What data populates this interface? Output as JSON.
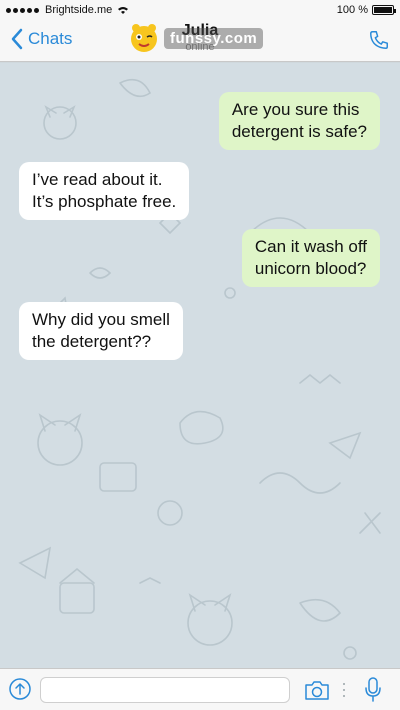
{
  "status_bar": {
    "carrier": "Brightside.me",
    "time": "",
    "battery_percent": "100 %",
    "battery_level": 1.0
  },
  "nav": {
    "back_label": "Chats",
    "contact_name": "Julia",
    "contact_status": "online"
  },
  "watermark": {
    "text": "funssy.com"
  },
  "messages": [
    {
      "direction": "out",
      "lines": [
        "Are you sure this",
        "detergent is safe?"
      ]
    },
    {
      "direction": "in",
      "lines": [
        "I’ve read about it.",
        "It’s phosphate free."
      ]
    },
    {
      "direction": "out",
      "lines": [
        "Can it wash off",
        "unicorn blood?"
      ]
    },
    {
      "direction": "in",
      "lines": [
        "Why did you smell",
        "the detergent??"
      ]
    }
  ],
  "input": {
    "value": "",
    "placeholder": ""
  },
  "colors": {
    "accent": "#2a8ad8",
    "outgoing_bubble": "#dff5c8",
    "incoming_bubble": "#ffffff",
    "chat_background": "#d3dde3"
  },
  "icons": [
    "signal-icon",
    "wifi-icon",
    "battery-icon",
    "chevron-left-icon",
    "phone-icon",
    "attach-icon",
    "camera-icon",
    "microphone-icon"
  ]
}
